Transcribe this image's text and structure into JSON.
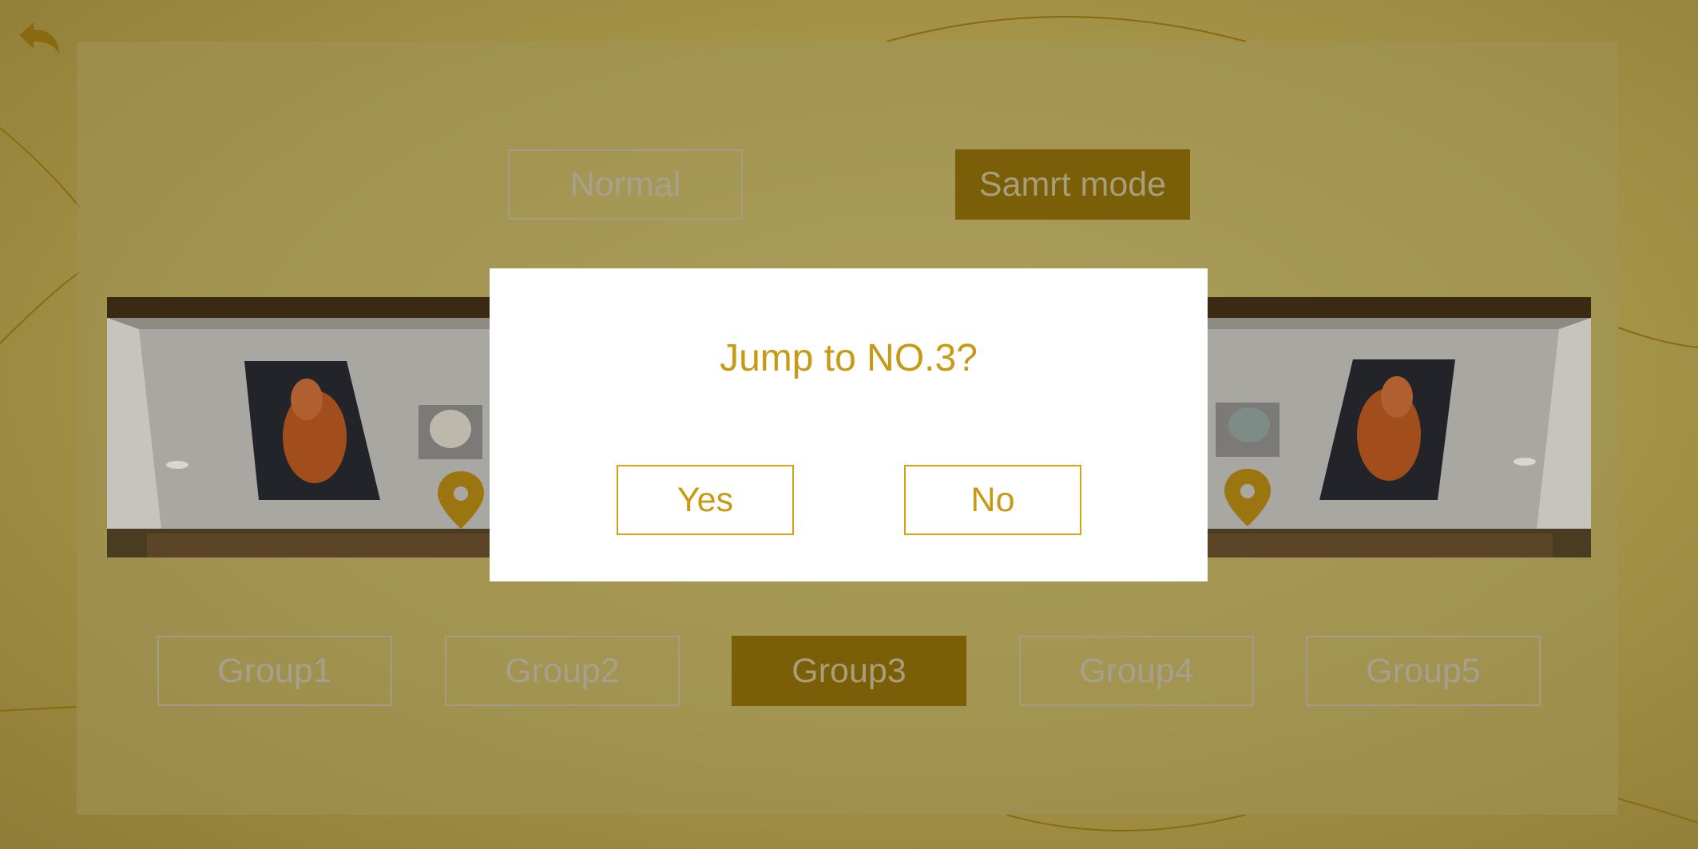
{
  "colors": {
    "accent": "#7a5e08",
    "dialog_text": "#c89a14",
    "inactive_text": "#a6a08c",
    "background": "#a8974a"
  },
  "header": {
    "back_icon": "back-arrow-icon"
  },
  "modes": {
    "normal_label": "Normal",
    "smart_label": "Samrt mode",
    "selected": "Samrt mode"
  },
  "gallery": {
    "location_icon": "map-pin-icon"
  },
  "groups": {
    "items": [
      {
        "label": "Group1",
        "active": false
      },
      {
        "label": "Group2",
        "active": false
      },
      {
        "label": "Group3",
        "active": true
      },
      {
        "label": "Group4",
        "active": false
      },
      {
        "label": "Group5",
        "active": false
      }
    ]
  },
  "dialog": {
    "title": "Jump to NO.3?",
    "yes_label": "Yes",
    "no_label": "No"
  }
}
